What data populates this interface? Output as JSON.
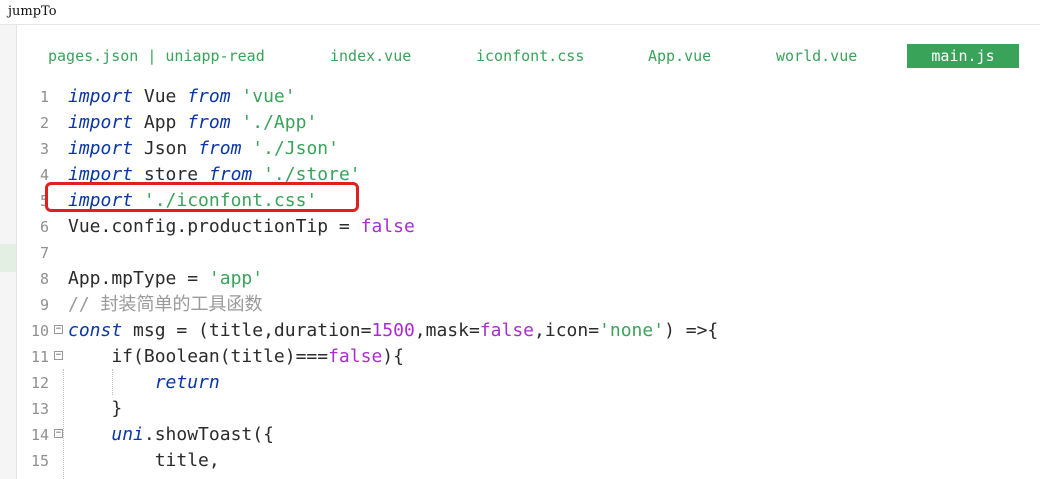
{
  "window": {
    "title": "jumpTo"
  },
  "tabs": [
    {
      "label": "pages.json | uniapp-read",
      "active": false
    },
    {
      "label": "index.vue",
      "active": false
    },
    {
      "label": "iconfont.css",
      "active": false
    },
    {
      "label": "App.vue",
      "active": false
    },
    {
      "label": "world.vue",
      "active": false
    },
    {
      "label": "main.js",
      "active": true
    }
  ],
  "colors": {
    "keyword": "#0a36a6",
    "string": "#3aa35a",
    "number": "#a82ecf",
    "comment": "#9a9a9a",
    "active_tab": "#3aa35a",
    "highlight_box": "#e02020"
  },
  "lines": [
    {
      "no": "1",
      "tokens": [
        [
          "kw",
          "import"
        ],
        [
          "plain",
          " Vue "
        ],
        [
          "kw",
          "from"
        ],
        [
          "plain",
          " "
        ],
        [
          "str",
          "'vue'"
        ]
      ]
    },
    {
      "no": "2",
      "tokens": [
        [
          "kw",
          "import"
        ],
        [
          "plain",
          " App "
        ],
        [
          "kw",
          "from"
        ],
        [
          "plain",
          " "
        ],
        [
          "str",
          "'./App'"
        ]
      ]
    },
    {
      "no": "3",
      "tokens": [
        [
          "kw",
          "import"
        ],
        [
          "plain",
          " Json "
        ],
        [
          "kw",
          "from"
        ],
        [
          "plain",
          " "
        ],
        [
          "str",
          "'./Json'"
        ]
      ]
    },
    {
      "no": "4",
      "tokens": [
        [
          "kw",
          "import"
        ],
        [
          "plain",
          " store "
        ],
        [
          "kw",
          "from"
        ],
        [
          "plain",
          " "
        ],
        [
          "str",
          "'./store'"
        ]
      ]
    },
    {
      "no": "5",
      "tokens": [
        [
          "kw",
          "import"
        ],
        [
          "plain",
          " "
        ],
        [
          "str",
          "'./iconfont.css'"
        ]
      ]
    },
    {
      "no": "6",
      "tokens": [
        [
          "plain",
          "Vue.config.productionTip = "
        ],
        [
          "boolv",
          "false"
        ]
      ]
    },
    {
      "no": "7",
      "tokens": []
    },
    {
      "no": "8",
      "tokens": [
        [
          "plain",
          "App.mpType = "
        ],
        [
          "str",
          "'app'"
        ]
      ]
    },
    {
      "no": "9",
      "tokens": [
        [
          "cmt",
          "// 封装简单的工具函数"
        ]
      ]
    },
    {
      "no": "10",
      "fold": true,
      "tokens": [
        [
          "kw",
          "const"
        ],
        [
          "plain",
          " msg = (title,duration="
        ],
        [
          "num",
          "1500"
        ],
        [
          "plain",
          ",mask="
        ],
        [
          "boolv",
          "false"
        ],
        [
          "plain",
          ",icon="
        ],
        [
          "str",
          "'none'"
        ],
        [
          "plain",
          ") =>{"
        ]
      ]
    },
    {
      "no": "11",
      "fold": true,
      "tokens": [
        [
          "plain",
          "    if(Boolean(title)==="
        ],
        [
          "boolv",
          "false"
        ],
        [
          "plain",
          "){"
        ]
      ]
    },
    {
      "no": "12",
      "tokens": [
        [
          "plain",
          "        "
        ],
        [
          "kw",
          "return"
        ]
      ]
    },
    {
      "no": "13",
      "tokens": [
        [
          "plain",
          "    }"
        ]
      ]
    },
    {
      "no": "14",
      "fold": true,
      "tokens": [
        [
          "plain",
          "    "
        ],
        [
          "uni",
          "uni"
        ],
        [
          "plain",
          ".showToast({"
        ]
      ]
    },
    {
      "no": "15",
      "tokens": [
        [
          "plain",
          "        title,"
        ]
      ]
    }
  ]
}
